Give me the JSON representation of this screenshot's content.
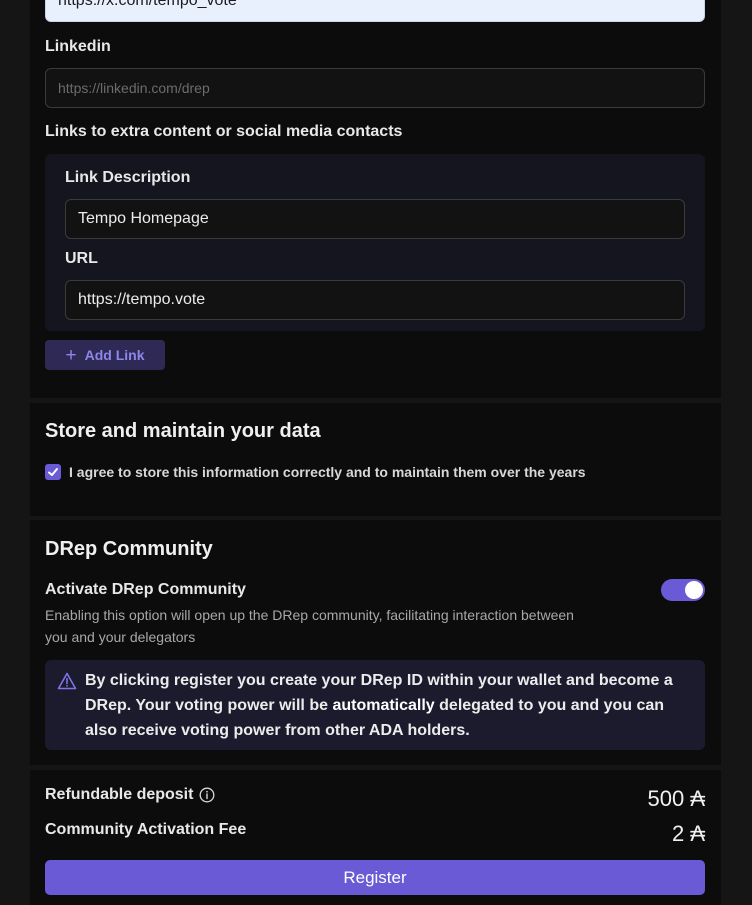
{
  "links_section": {
    "x_field_value": "https://x.com/tempo_vote",
    "linkedin_label": "Linkedin",
    "linkedin_placeholder": "https://linkedin.com/drep",
    "extra_links_label": "Links to extra content or social media contacts",
    "link_description_label": "Link Description",
    "link_description_value": "Tempo Homepage",
    "url_label": "URL",
    "url_value": "https://tempo.vote",
    "add_link_label": "Add Link"
  },
  "store_section": {
    "title": "Store and maintain your data",
    "checkbox_checked": true,
    "checkbox_label": "I agree to store this information correctly and to maintain them over the years"
  },
  "community_section": {
    "title": "DRep Community",
    "toggle_label": "Activate DRep Community",
    "toggle_on": true,
    "toggle_description": "Enabling this option will open up the DRep community, facilitating interaction between you and your delegators",
    "alert_text_before": "By clicking register you create your DRep ID within your wallet and become a DRep. Your voting power will be ",
    "alert_text_bold": "automatically",
    "alert_text_after": " delegated to you and you can also receive voting power from other ADA holders."
  },
  "deposit_section": {
    "refundable_label": "Refundable deposit",
    "refundable_amount": "500 ₳",
    "fee_label": "Community Activation Fee",
    "fee_amount": "2 ₳",
    "register_label": "Register"
  },
  "colors": {
    "accent": "#6a5ad5",
    "page_bg": "#151515",
    "panel_bg": "#0c0c0c"
  }
}
